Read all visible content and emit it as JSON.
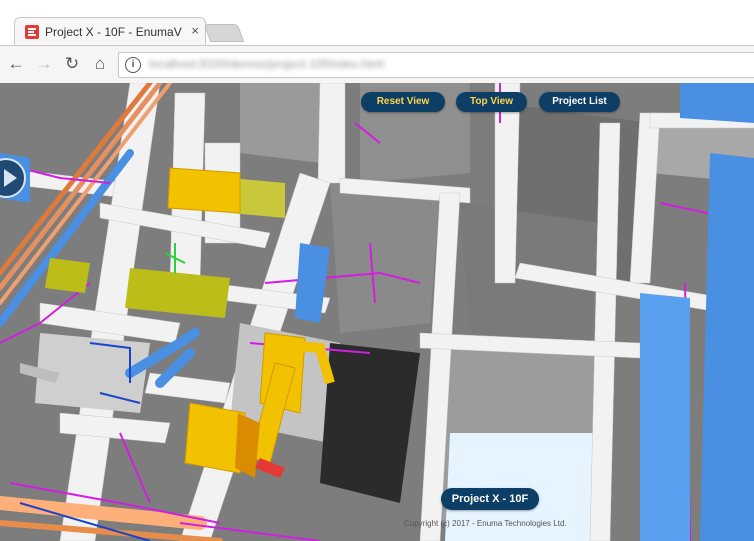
{
  "browser": {
    "tab_title": "Project X - 10F - EnumaV",
    "tab_close": "×",
    "url": "localhost:8100/demos/project-10f/index.html",
    "nav": {
      "back": "←",
      "forward": "→",
      "reload": "↻",
      "home": "⌂"
    },
    "info": "i"
  },
  "viewer": {
    "reset_view": "Reset View",
    "top_view": "Top View",
    "project_list": "Project List",
    "project_name": "Project X - 10F",
    "copyright": "Copyright (c) 2017 - Enuma Technologies Ltd."
  },
  "colors": {
    "button_bg": "#0d3f66",
    "button_accent": "#ffd54a",
    "duct_yellow": "#f2c200",
    "pipe_blue": "#4a90e2",
    "cable_magenta": "#d21ee0",
    "wall_grey": "#e6e6e6",
    "brand_red": "#e53935"
  }
}
